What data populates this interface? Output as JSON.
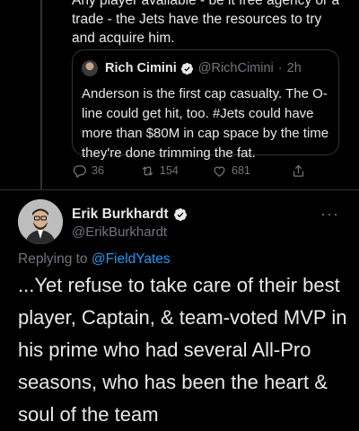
{
  "previous_tweet": {
    "text": "Any player available - be it free agency or a trade - the Jets have the resources to try and acquire him."
  },
  "quote_tweet": {
    "author_name": "Rich Cimini",
    "author_handle": "@RichCimini",
    "separator": "·",
    "time": "2h",
    "body_before": "Anderson is the first cap casualty. The O-line could get hit, too. ",
    "hashtag": "#Jets",
    "body_after": " could have more than $80M in cap space by the time they're done trimming the fat."
  },
  "actions": {
    "reply_count": "36",
    "retweet_count": "154",
    "like_count": "681"
  },
  "tweet": {
    "author_name": "Erik Burkhardt",
    "author_handle": "@ErikBurkhardt",
    "more_label": "···",
    "replying_prefix": "Replying to ",
    "replying_to": "@FieldYates",
    "text": "...Yet refuse to take care of their best player, Captain, & team-voted MVP in his prime who had several All-Pro seasons, who has been the heart & soul of the team"
  },
  "colors": {
    "background": "#000000",
    "text_primary": "#e7e9ea",
    "text_secondary": "#71767b",
    "accent": "#1d9bf0",
    "border": "#2f3336"
  },
  "icons": {
    "reply": "reply-icon",
    "retweet": "retweet-icon",
    "like": "like-icon",
    "share": "share-icon",
    "verified": "verified-badge-icon",
    "more": "more-icon"
  }
}
